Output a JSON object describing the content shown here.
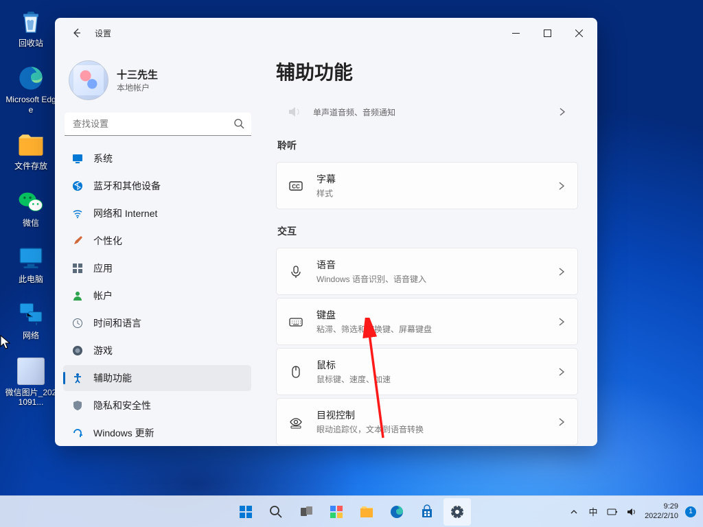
{
  "desktop": {
    "icons": [
      {
        "label": "回收站"
      },
      {
        "label": "Microsoft Edge"
      },
      {
        "label": "文件存放"
      },
      {
        "label": "微信"
      },
      {
        "label": "此电脑"
      },
      {
        "label": "网络"
      },
      {
        "label": "微信图片_2021091..."
      }
    ]
  },
  "window": {
    "title": "设置",
    "user": {
      "name": "十三先生",
      "type": "本地帐户"
    },
    "search_placeholder": "查找设置",
    "nav": [
      {
        "label": "系统"
      },
      {
        "label": "蓝牙和其他设备"
      },
      {
        "label": "网络和 Internet"
      },
      {
        "label": "个性化"
      },
      {
        "label": "应用"
      },
      {
        "label": "帐户"
      },
      {
        "label": "时间和语言"
      },
      {
        "label": "游戏"
      },
      {
        "label": "辅助功能"
      },
      {
        "label": "隐私和安全性"
      },
      {
        "label": "Windows 更新"
      }
    ],
    "page_title": "辅助功能",
    "partial_sub": "单声道音频、音频通知",
    "sections": {
      "hearing": {
        "label": "聆听",
        "items": [
          {
            "title": "字幕",
            "sub": "样式"
          }
        ]
      },
      "interaction": {
        "label": "交互",
        "items": [
          {
            "title": "语音",
            "sub": "Windows 语音识别、语音键入"
          },
          {
            "title": "键盘",
            "sub": "粘滞、筛选和切换键、屏幕键盘"
          },
          {
            "title": "鼠标",
            "sub": "鼠标键、速度、加速"
          },
          {
            "title": "目视控制",
            "sub": "眼动追踪仪，文本到语音转换"
          }
        ]
      }
    }
  },
  "taskbar": {
    "ime": "中",
    "time": "9:29",
    "date": "2022/2/10",
    "badge": "1"
  }
}
